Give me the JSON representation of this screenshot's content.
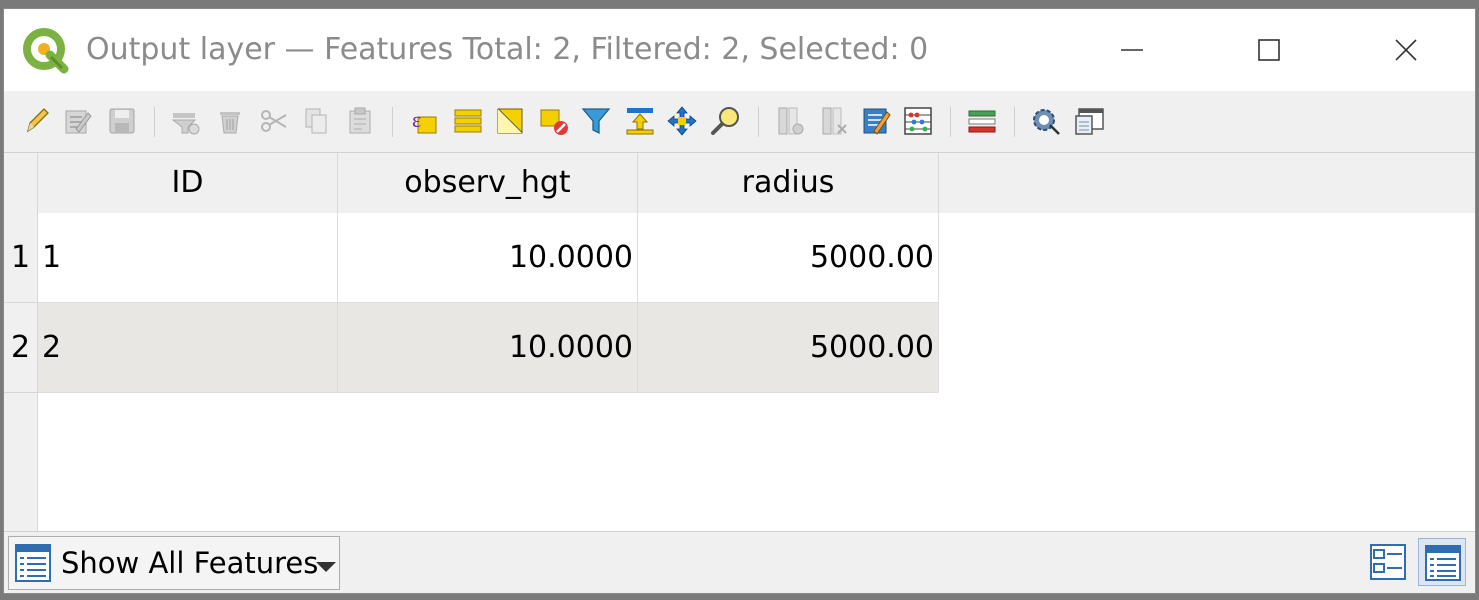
{
  "window": {
    "title": "Output layer — Features Total: 2, Filtered: 2, Selected: 0"
  },
  "table": {
    "columns": [
      "ID",
      "observ_hgt",
      "radius"
    ],
    "rows": [
      {
        "row_number": "1",
        "cells": [
          "1",
          "10.0000",
          "5000.00"
        ]
      },
      {
        "row_number": "2",
        "cells": [
          "2",
          "10.0000",
          "5000.00"
        ]
      }
    ]
  },
  "statusbar": {
    "filter_label": "Show All Features"
  },
  "colors": {
    "alt_row": "#e9e7e3",
    "header_bg": "#f0f0f0",
    "title_text": "#8b8b8b"
  }
}
